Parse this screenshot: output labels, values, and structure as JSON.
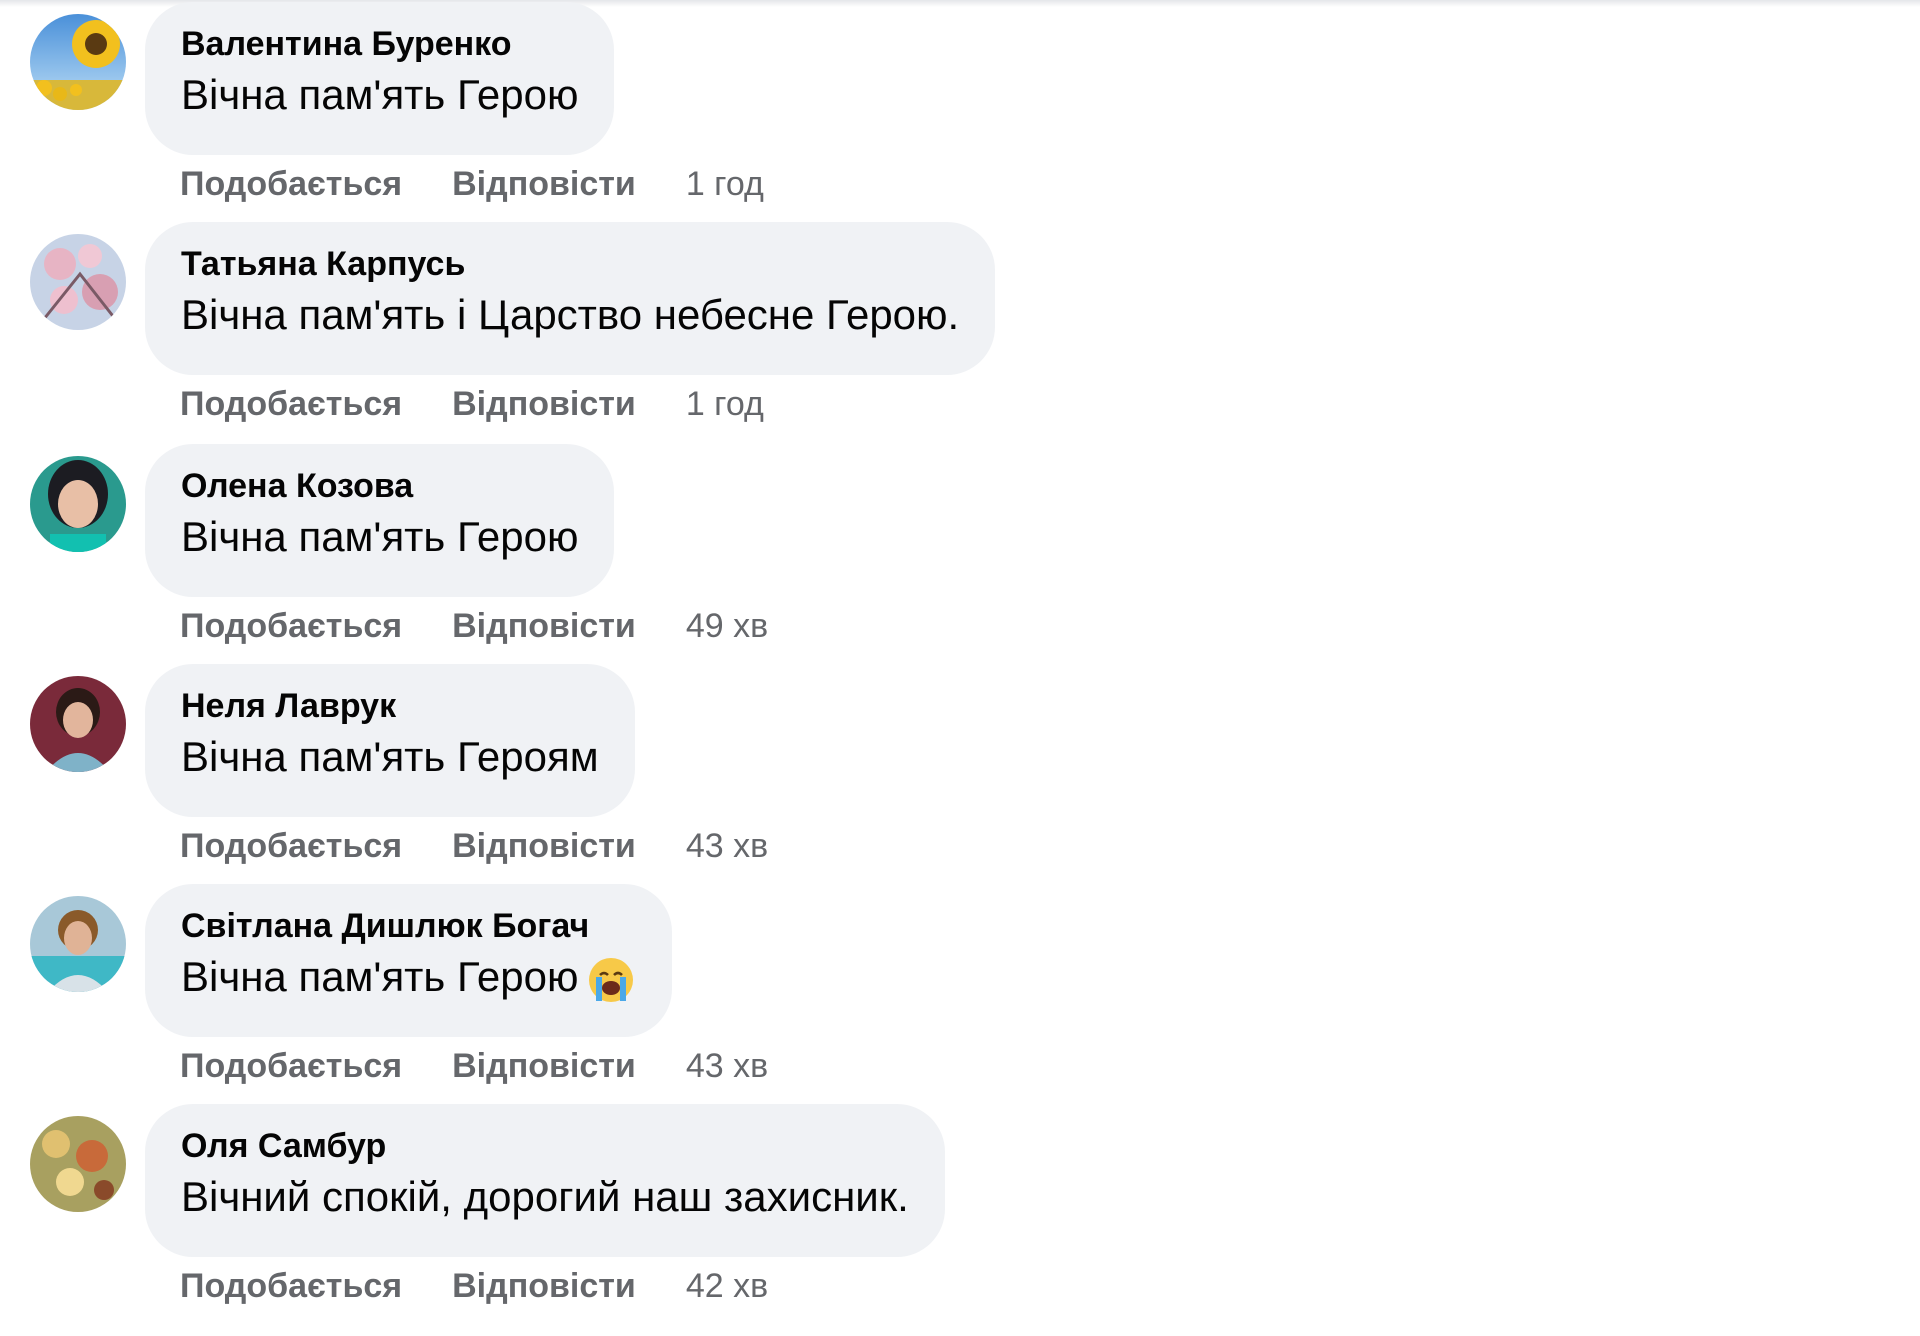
{
  "comments": [
    {
      "author": "Валентина Буренко",
      "text": "Вічна пам'ять Герою",
      "like_label": "Подобається",
      "reply_label": "Відповісти",
      "time": "1 год",
      "avatar": "sunflower-avatar"
    },
    {
      "author": "Татьяна Карпусь",
      "text": "Вічна пам'ять і Царство небесне Герою.",
      "like_label": "Подобається",
      "reply_label": "Відповісти",
      "time": "1 год",
      "avatar": "blossom-avatar"
    },
    {
      "author": "Олена Козова",
      "text": "Вічна пам'ять Герою",
      "like_label": "Подобається",
      "reply_label": "Відповісти",
      "time": "49 хв",
      "avatar": "portrait-avatar"
    },
    {
      "author": "Неля Лаврук",
      "text": "Вічна пам'ять Героям",
      "like_label": "Подобається",
      "reply_label": "Відповісти",
      "time": "43 хв",
      "avatar": "portrait-avatar"
    },
    {
      "author": "Світлана Дишлюк Богач",
      "text": "Вічна пам'ять Герою",
      "like_label": "Подобається",
      "reply_label": "Відповісти",
      "time": "43 хв",
      "avatar": "portrait-avatar",
      "emoji": "loudly-crying-face-emoji"
    },
    {
      "author": "Оля Самбур",
      "text": "Вічний спокій, дорогий наш захисник.",
      "like_label": "Подобається",
      "reply_label": "Відповісти",
      "time": "42 хв",
      "avatar": "flowers-avatar"
    }
  ],
  "colors": {
    "bubble": "#f0f2f5",
    "text": "#050505",
    "secondary": "#65676b"
  }
}
